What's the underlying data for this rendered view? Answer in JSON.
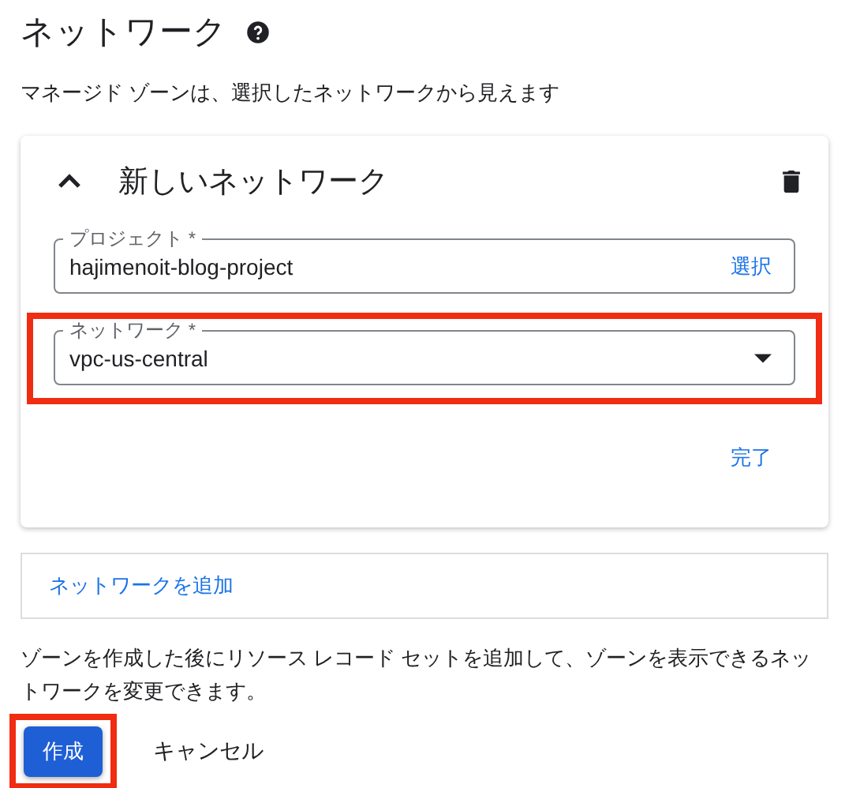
{
  "section": {
    "title": "ネットワーク",
    "description": "マネージド ゾーンは、選択したネットワークから見えます"
  },
  "network_card": {
    "title": "新しいネットワーク",
    "expanded": true,
    "fields": [
      {
        "kind": "text",
        "label": "プロジェクト *",
        "value": "hajimenoit-blog-project",
        "action": "選択",
        "highlighted": false
      },
      {
        "kind": "select",
        "label": "ネットワーク *",
        "value": "vpc-us-central",
        "highlighted": true
      }
    ],
    "done_button": "完了"
  },
  "add_network_link": "ネットワークを追加",
  "note": "ゾーンを作成した後にリソース レコード セットを追加して、ゾーンを表示できるネットワークを変更できます。",
  "buttons": [
    {
      "kind": "primary",
      "label": "作成",
      "highlighted": true
    },
    {
      "kind": "text",
      "label": "キャンセル",
      "highlighted": false
    }
  ]
}
